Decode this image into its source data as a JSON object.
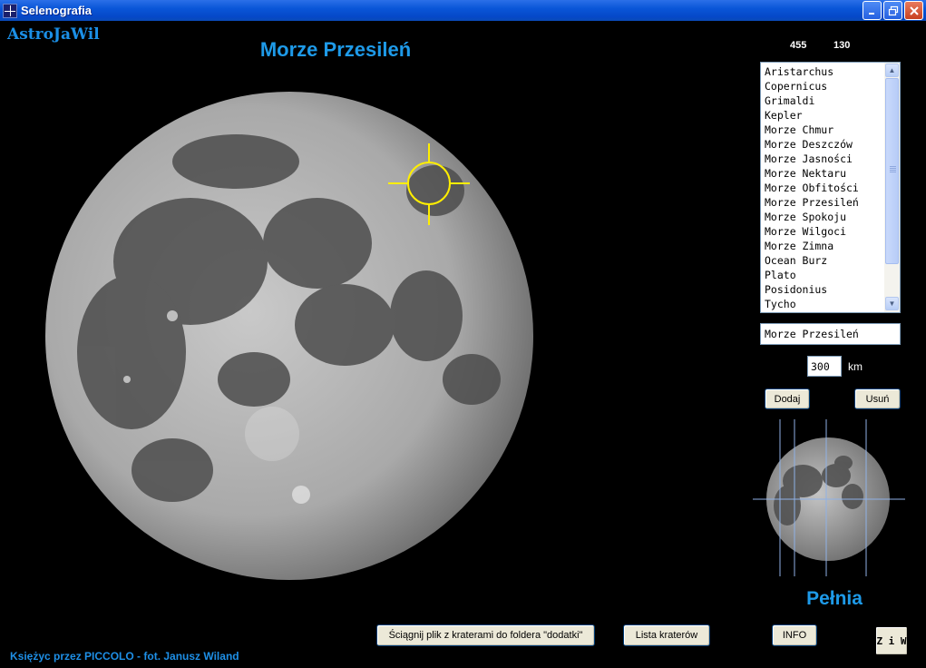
{
  "window": {
    "title": "Selenografia"
  },
  "brand": "AstroJaWil",
  "heading": "Morze Przesileń",
  "coords": {
    "x": "455",
    "y": "130"
  },
  "crater_list": [
    "Aristarchus",
    "Copernicus",
    "Grimaldi",
    "Kepler",
    "Morze Chmur",
    "Morze Deszczów",
    "Morze Jasności",
    "Morze Nektaru",
    "Morze Obfitości",
    "Morze Przesileń",
    "Morze Spokoju",
    "Morze Wilgoci",
    "Morze Zimna",
    "Ocean Burz",
    "Plato",
    "Posidonius",
    "Tycho"
  ],
  "selected_name": "Morze Przesileń",
  "diameter": {
    "value": "300",
    "unit": "km"
  },
  "buttons": {
    "add": "Dodaj",
    "remove": "Usuń",
    "download": "Ściągnij plik z kraterami do foldera \"dodatki\"",
    "crater_list": "Lista kraterów",
    "info": "INFO",
    "ziw": "Z i W"
  },
  "phase": "Pełnia",
  "footer": "Księżyc przez PICCOLO - fot. Janusz Wiland",
  "colors": {
    "accent": "#1e9ae8",
    "marker": "#ffee00",
    "titlebar": "#0a56d8"
  },
  "icons": {
    "minimize": "minimize-icon",
    "maximize": "maximize-icon",
    "close": "close-icon"
  }
}
